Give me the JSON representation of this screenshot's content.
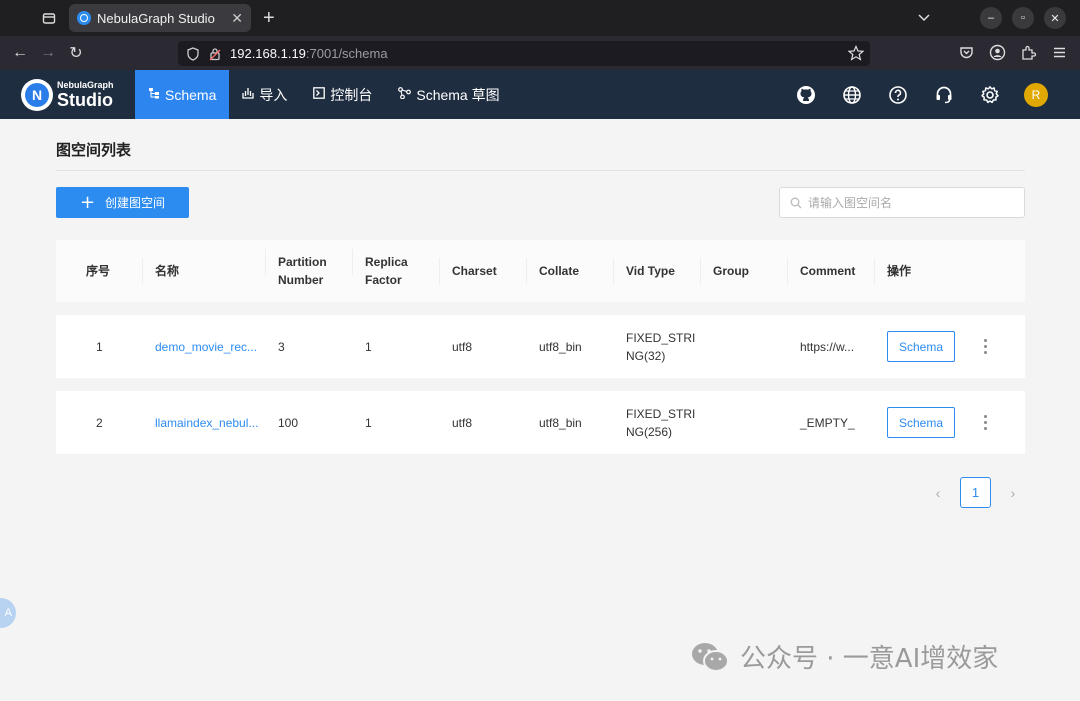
{
  "browser": {
    "tab_title": "NebulaGraph Studio",
    "url_host": "192.168.1.19",
    "url_path": ":7001/schema"
  },
  "app": {
    "logo_small": "NebulaGraph",
    "logo_big": "Studio",
    "menu": [
      {
        "label": "Schema",
        "icon": "schema-icon"
      },
      {
        "label": "导入",
        "icon": "import-icon"
      },
      {
        "label": "控制台",
        "icon": "console-icon"
      },
      {
        "label": "Schema 草图",
        "icon": "sketch-icon"
      }
    ],
    "avatar_letter": "R"
  },
  "page": {
    "title": "图空间列表",
    "create_label": "创建图空间",
    "search_placeholder": "请输入图空间名",
    "columns": {
      "index": "序号",
      "name": "名称",
      "partition_1": "Partition",
      "partition_2": "Number",
      "replica_1": "Replica",
      "replica_2": "Factor",
      "charset": "Charset",
      "collate": "Collate",
      "vid_type": "Vid Type",
      "group": "Group",
      "comment": "Comment",
      "ops": "操作"
    },
    "rows": [
      {
        "index": "1",
        "name": "demo_movie_rec...",
        "partition": "3",
        "replica": "1",
        "charset": "utf8",
        "collate": "utf8_bin",
        "vid_1": "FIXED_STRI",
        "vid_2": "NG(32)",
        "group": "",
        "comment": "https://w...",
        "schema_label": "Schema"
      },
      {
        "index": "2",
        "name": "llamaindex_nebul...",
        "partition": "100",
        "replica": "1",
        "charset": "utf8",
        "collate": "utf8_bin",
        "vid_1": "FIXED_STRI",
        "vid_2": "NG(256)",
        "group": "",
        "comment": "_EMPTY_",
        "schema_label": "Schema"
      }
    ],
    "current_page": "1"
  },
  "overlay": {
    "side_badge": "A",
    "watermark": "公众号 · 一意AI增效家"
  }
}
